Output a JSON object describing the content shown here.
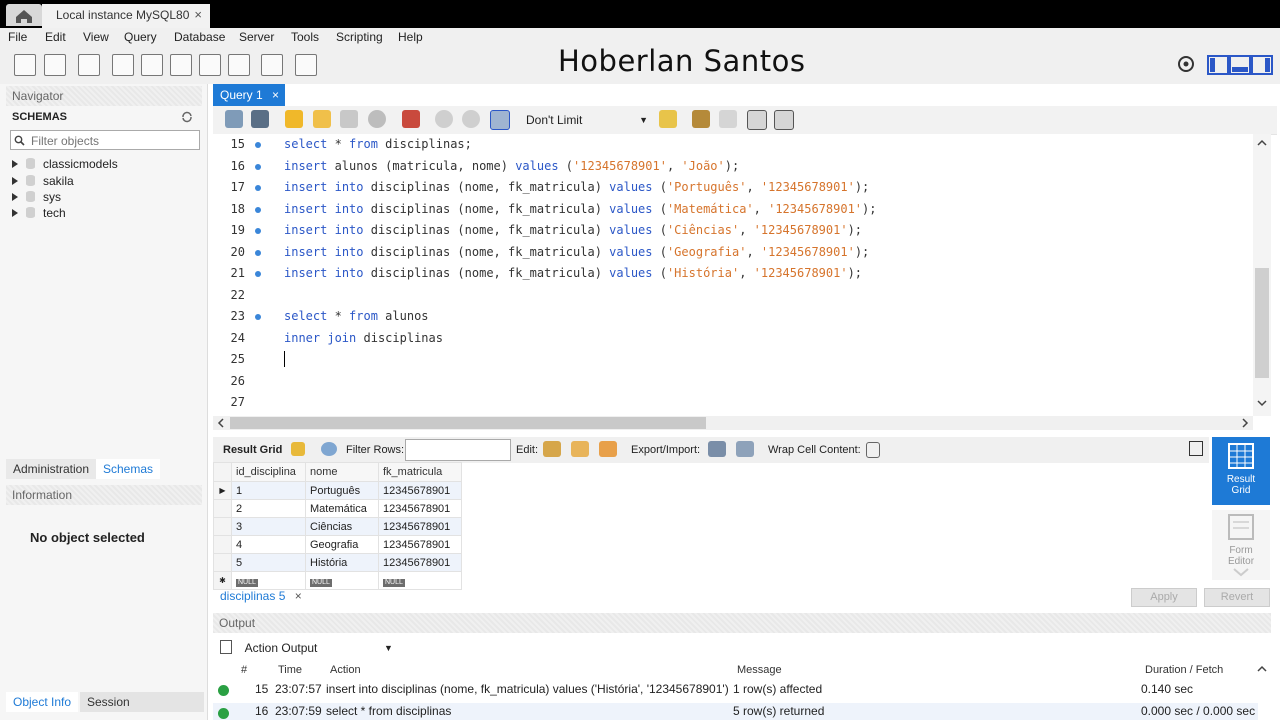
{
  "connection_tab": {
    "label": "Local instance MySQL80",
    "close": "×"
  },
  "menu": [
    "File",
    "Edit",
    "View",
    "Query",
    "Database",
    "Server",
    "Tools",
    "Scripting",
    "Help"
  ],
  "watermark": "Hoberlan  Santos",
  "navigator": {
    "title": "Navigator",
    "schemas_label": "SCHEMAS",
    "filter_placeholder": "Filter objects",
    "schemas": [
      "classicmodels",
      "sakila",
      "sys",
      "tech"
    ]
  },
  "left_tabs": {
    "administration": "Administration",
    "schemas": "Schemas"
  },
  "information": {
    "title": "Information",
    "no_object": "No object selected"
  },
  "bottom_tabs": {
    "object_info": "Object Info",
    "session": "Session"
  },
  "query_tab": {
    "label": "Query 1",
    "close": "×"
  },
  "limit_select": "Don't Limit",
  "editor": {
    "lines": [
      {
        "n": "15",
        "dot": true
      },
      {
        "n": "16",
        "dot": true
      },
      {
        "n": "17",
        "dot": true
      },
      {
        "n": "18",
        "dot": true
      },
      {
        "n": "19",
        "dot": true
      },
      {
        "n": "20",
        "dot": true
      },
      {
        "n": "21",
        "dot": true
      },
      {
        "n": "22",
        "dot": false
      },
      {
        "n": "23",
        "dot": true
      },
      {
        "n": "24",
        "dot": false
      },
      {
        "n": "25",
        "dot": false
      },
      {
        "n": "26",
        "dot": false
      },
      {
        "n": "27",
        "dot": false
      }
    ],
    "code": {
      "l15": {
        "k1": "select",
        "t1": " * ",
        "k2": "from",
        "t2": " disciplinas;"
      },
      "l16": {
        "k1": "insert",
        "t1": " alunos (matricula, nome) ",
        "k2": "values",
        "t2": " (",
        "s1": "'12345678901'",
        "t3": ", ",
        "s2": "'João'",
        "t4": ");"
      },
      "l17": {
        "k1": "insert",
        "k2": "into",
        "t1": " disciplinas (nome, fk_matricula) ",
        "k3": "values",
        "t2": " (",
        "s1": "'Português'",
        "t3": ", ",
        "s2": "'12345678901'",
        "t4": ");"
      },
      "l18": {
        "k1": "insert",
        "k2": "into",
        "t1": " disciplinas (nome, fk_matricula) ",
        "k3": "values",
        "t2": " (",
        "s1": "'Matemática'",
        "t3": ", ",
        "s2": "'12345678901'",
        "t4": ");"
      },
      "l19": {
        "k1": "insert",
        "k2": "into",
        "t1": " disciplinas (nome, fk_matricula) ",
        "k3": "values",
        "t2": " (",
        "s1": "'Ciências'",
        "t3": ", ",
        "s2": "'12345678901'",
        "t4": ");"
      },
      "l20": {
        "k1": "insert",
        "k2": "into",
        "t1": " disciplinas (nome, fk_matricula) ",
        "k3": "values",
        "t2": " (",
        "s1": "'Geografia'",
        "t3": ", ",
        "s2": "'12345678901'",
        "t4": ");"
      },
      "l21": {
        "k1": "insert",
        "k2": "into",
        "t1": " disciplinas (nome, fk_matricula) ",
        "k3": "values",
        "t2": " (",
        "s1": "'História'",
        "t3": ", ",
        "s2": "'12345678901'",
        "t4": ");"
      },
      "l23": {
        "k1": "select",
        "t1": " * ",
        "k2": "from",
        "t2": " alunos"
      },
      "l24": {
        "k1": "inner",
        "k2": "join",
        "t1": " disciplinas"
      }
    }
  },
  "result_toolbar": {
    "result_grid": "Result Grid",
    "filter_rows": "Filter Rows:",
    "edit": "Edit:",
    "export_import": "Export/Import:",
    "wrap": "Wrap Cell Content:"
  },
  "grid": {
    "columns": [
      "id_disciplina",
      "nome",
      "fk_matricula"
    ],
    "rows": [
      [
        "1",
        "Português",
        "12345678901"
      ],
      [
        "2",
        "Matemática",
        "12345678901"
      ],
      [
        "3",
        "Ciências",
        "12345678901"
      ],
      [
        "4",
        "Geografia",
        "12345678901"
      ],
      [
        "5",
        "História",
        "12345678901"
      ]
    ],
    "null_label": "NULL"
  },
  "side_buttons": {
    "result_grid": "Result Grid",
    "form_editor": "Form Editor"
  },
  "result_tab": {
    "label": "disciplinas 5",
    "close": "×"
  },
  "buttons": {
    "apply": "Apply",
    "revert": "Revert"
  },
  "output": {
    "title": "Output",
    "selector": "Action Output",
    "headers": {
      "num": "#",
      "time": "Time",
      "action": "Action",
      "message": "Message",
      "duration": "Duration / Fetch"
    },
    "rows": [
      {
        "num": "15",
        "time": "23:07:57",
        "action": "insert into disciplinas (nome, fk_matricula) values ('História', '12345678901')",
        "message": "1 row(s) affected",
        "duration": "0.140 sec"
      },
      {
        "num": "16",
        "time": "23:07:59",
        "action": "select * from disciplinas",
        "message": "5 row(s) returned",
        "duration": "0.000 sec / 0.000 sec"
      }
    ]
  },
  "colors": {
    "accent": "#1e7ad6",
    "keyword": "#2b57c7",
    "string": "#d6742c",
    "ok": "#2aa043"
  }
}
